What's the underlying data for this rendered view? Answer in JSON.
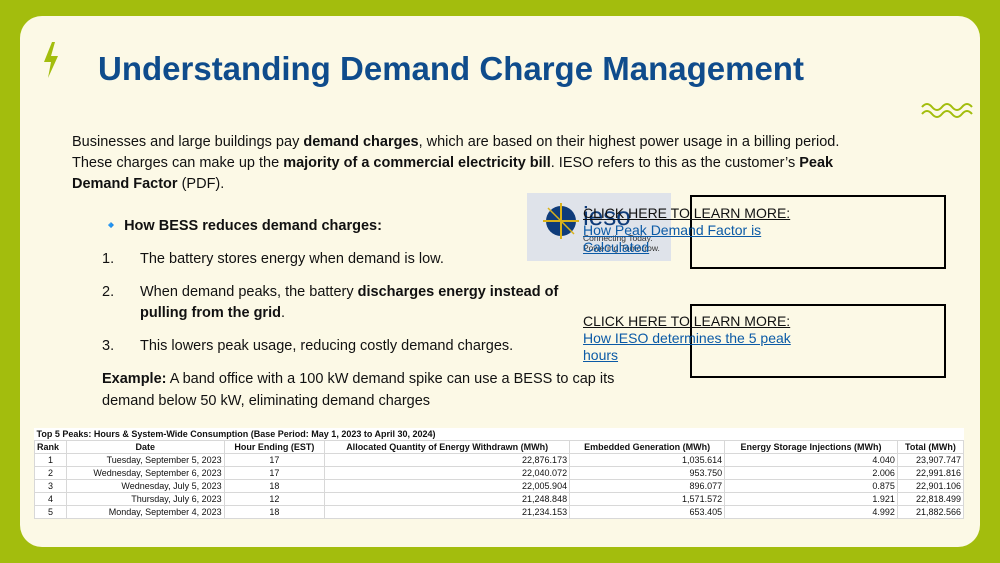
{
  "slide": {
    "title": "Understanding Demand Charge Management",
    "intro": {
      "t1": "Businesses and large buildings pay ",
      "b1": "demand charges",
      "t2": ", which are based on their highest power usage in a billing period. These charges can make up the ",
      "b2": "majority of a commercial electricity bill",
      "t3": ". IESO refers to this as the customer’s ",
      "b3": "Peak Demand Factor",
      "t4": " (PDF)."
    },
    "how_heading": "🔹 How BESS reduces demand charges:",
    "steps": [
      {
        "num": "1.",
        "text": "The battery stores energy when demand is low."
      },
      {
        "num": "2.",
        "pre": "When demand peaks, the battery ",
        "bold": "discharges energy instead of pulling from the grid",
        "post": "."
      },
      {
        "num": "3.",
        "text": "This lowers peak usage, reducing costly demand charges."
      }
    ],
    "example": {
      "label": "Example:",
      "text": " A band office with a 100 kW demand spike can use a BESS to cap its demand below 50 kW, eliminating demand charges"
    },
    "logo": {
      "name": "ieso",
      "tagline1": "Connecting Today.",
      "tagline2": "Powering Tomorrow."
    },
    "links": [
      {
        "prefix": "CLICK HERE TO LEARN MORE:  ",
        "text": "How Peak Demand Factor is Calculated"
      },
      {
        "prefix": "CLICK HERE TO LEARN MORE:  ",
        "text": "How IESO determines the 5 peak hours"
      }
    ],
    "table": {
      "caption": "Top 5 Peaks: Hours & System-Wide Consumption  (Base Period: May 1, 2023 to April 30, 2024)",
      "headers": [
        "Rank",
        "Date",
        "Hour Ending (EST)",
        "Allocated Quantity of Energy Withdrawn (MWh)",
        "Embedded Generation (MWh)",
        "Energy Storage Injections (MWh)",
        "Total (MWh)"
      ],
      "rows": [
        [
          "1",
          "Tuesday, September 5, 2023",
          "17",
          "22,876.173",
          "1,035.614",
          "4.040",
          "23,907.747"
        ],
        [
          "2",
          "Wednesday, September 6, 2023",
          "17",
          "22,040.072",
          "953.750",
          "2.006",
          "22,991.816"
        ],
        [
          "3",
          "Wednesday, July 5, 2023",
          "18",
          "22,005.904",
          "896.077",
          "0.875",
          "22,901.106"
        ],
        [
          "4",
          "Thursday, July 6, 2023",
          "12",
          "21,248.848",
          "1,571.572",
          "1.921",
          "22,818.499"
        ],
        [
          "5",
          "Monday, September 4, 2023",
          "18",
          "21,234.153",
          "653.405",
          "4.992",
          "21,882.566"
        ]
      ]
    },
    "colors": {
      "frame": "#a3bd0d",
      "card": "#fcf9e6",
      "title": "#0f4c8c",
      "accent": "#a3bd0d"
    },
    "icons": [
      "lightning-icon",
      "wave-squiggle-icon"
    ]
  }
}
